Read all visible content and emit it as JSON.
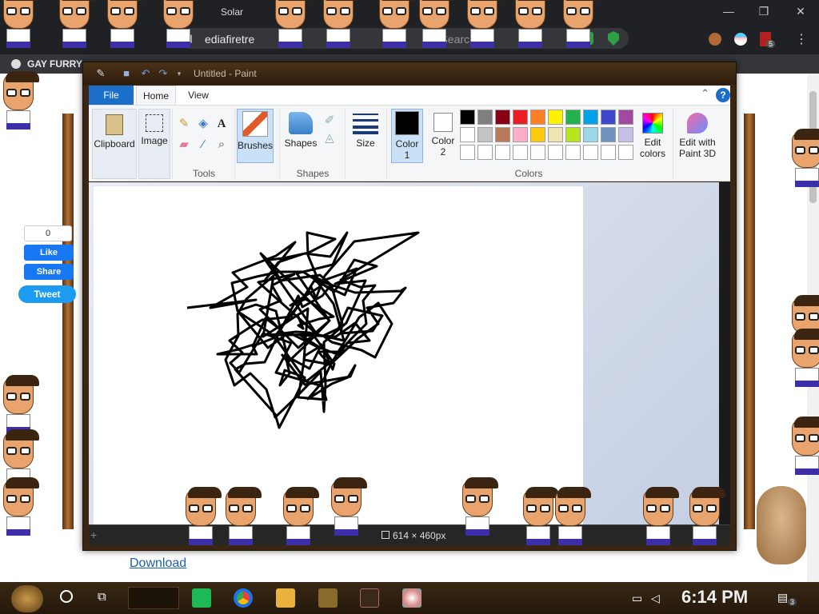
{
  "browser": {
    "tab_title": "Solar",
    "url_fragment": "ediafiretre",
    "search_placeholder": "ch-Search",
    "bookmark_first": "GAY FURRY",
    "extension_badge": "5",
    "window_controls": {
      "minimize": "—",
      "maximize": "❐",
      "close": "✕"
    }
  },
  "webpage": {
    "fb_like_count": "0",
    "fb_like_label": "Like",
    "fb_share_label": "Share",
    "tweet_label": "Tweet",
    "download_label": "Download"
  },
  "paint": {
    "title": "Untitled - Paint",
    "tabs": {
      "file": "File",
      "home": "Home",
      "view": "View"
    },
    "help": "?",
    "groups": {
      "clipboard": "Clipboard",
      "image": "Image",
      "tools": "Tools",
      "brushes": "Brushes",
      "shapes_btn": "Shapes",
      "shapes": "Shapes",
      "size": "Size",
      "color1_a": "Color",
      "color1_b": "1",
      "color2_a": "Color",
      "color2_b": "2",
      "colors": "Colors",
      "edit_colors_a": "Edit",
      "edit_colors_b": "colors",
      "paint3d_a": "Edit with",
      "paint3d_b": "Paint 3D"
    },
    "palette_row1": [
      "#000000",
      "#7f7f7f",
      "#880015",
      "#ed1c24",
      "#ff7f27",
      "#fff200",
      "#22b14c",
      "#00a2e8",
      "#3f48cc",
      "#a349a4"
    ],
    "palette_row2": [
      "#ffffff",
      "#c3c3c3",
      "#b97a57",
      "#ffaec9",
      "#ffc90e",
      "#efe4b0",
      "#b5e61d",
      "#99d9ea",
      "#7092be",
      "#c8bfe7"
    ],
    "palette_row3": [
      "#ffffff",
      "#ffffff",
      "#ffffff",
      "#ffffff",
      "#ffffff",
      "#ffffff",
      "#ffffff",
      "#ffffff",
      "#ffffff",
      "#ffffff"
    ],
    "color1": "#000000",
    "color2": "#ffffff",
    "canvas_size": "614 × 460px"
  },
  "taskbar": {
    "time": "6:14 PM",
    "notification_count": "3"
  }
}
